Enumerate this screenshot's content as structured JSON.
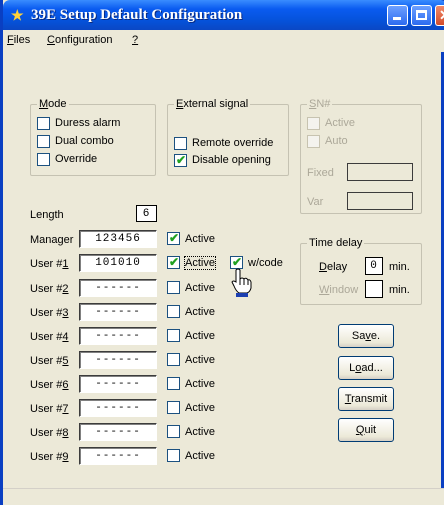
{
  "window": {
    "title": "39E Setup  Default  Configuration"
  },
  "menu": {
    "files": "iles",
    "files_u": "F",
    "configuration": "onfiguration",
    "configuration_u": "C",
    "help": "?"
  },
  "mode": {
    "legend_u": "M",
    "legend": "ode",
    "items": [
      {
        "label": "Duress alarm",
        "checked": false
      },
      {
        "label": "Dual combo",
        "checked": false
      },
      {
        "label": "Override",
        "checked": false
      }
    ]
  },
  "external": {
    "legend_u": "E",
    "legend": "xternal signal",
    "items": [
      {
        "label": "Remote override",
        "checked": false
      },
      {
        "label": "Disable opening",
        "checked": true
      }
    ]
  },
  "sn": {
    "legend_u": "S",
    "legend": "N#",
    "active": "Active",
    "auto": "Auto",
    "fixed": "Fixed",
    "var": "Var"
  },
  "length": {
    "label": "Length",
    "value": "6"
  },
  "users": [
    {
      "label": "Manager",
      "value": "123456",
      "active_label": "Active",
      "checked": true
    },
    {
      "label_pre": "User #",
      "label_u": "1",
      "value": "101010",
      "active_label": "Active",
      "checked": true
    },
    {
      "label_pre": "User #",
      "label_u": "2",
      "value": "------",
      "active_label": "Active",
      "checked": false
    },
    {
      "label_pre": "User #",
      "label_u": "3",
      "value": "------",
      "active_label": "Active",
      "checked": false
    },
    {
      "label_pre": "User #",
      "label_u": "4",
      "value": "------",
      "active_label": "Active",
      "checked": false
    },
    {
      "label_pre": "User #",
      "label_u": "5",
      "value": "------",
      "active_label": "Active",
      "checked": false
    },
    {
      "label_pre": "User #",
      "label_u": "6",
      "value": "------",
      "active_label": "Active",
      "checked": false
    },
    {
      "label_pre": "User #",
      "label_u": "7",
      "value": "------",
      "active_label": "Active",
      "checked": false
    },
    {
      "label_pre": "User #",
      "label_u": "8",
      "value": "------",
      "active_label": "Active",
      "checked": false
    },
    {
      "label_pre": "User #",
      "label_u": "9",
      "value": "------",
      "active_label": "Active",
      "checked": false
    }
  ],
  "wcode": {
    "label": "w/code",
    "checked": true
  },
  "time_delay": {
    "legend": "Time delay",
    "delay_u": "D",
    "delay": "elay",
    "delay_value": "0",
    "delay_unit": "min.",
    "window_u": "W",
    "window": "indow",
    "window_value": "",
    "window_unit": "min."
  },
  "buttons": {
    "save_pre": "Sa",
    "save_u": "v",
    "save_post": "e.",
    "load_pre": "L",
    "load_u": "o",
    "load_post": "ad...",
    "transmit_u": "T",
    "transmit": "ransmit",
    "quit_u": "Q",
    "quit": "uit"
  },
  "colors": {
    "title_bar": "#0552d9",
    "window_bg": "#ece9d8",
    "check_green": "#21a121"
  }
}
